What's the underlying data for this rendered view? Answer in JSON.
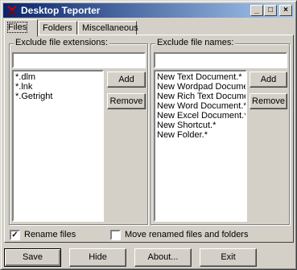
{
  "window": {
    "title": "Desktop Teporter"
  },
  "title_controls": {
    "minimize": "_",
    "maximize": "□",
    "close": "×"
  },
  "tabs": [
    {
      "label": "Files"
    },
    {
      "label": "Folders"
    },
    {
      "label": "Miscellaneous"
    }
  ],
  "extensions": {
    "legend": "Exclude file extensions:",
    "input_value": "",
    "items": [
      "*.dlm",
      "*.lnk",
      "*.Getright"
    ],
    "add_label": "Add",
    "remove_label": "Remove"
  },
  "names": {
    "legend": "Exclude file names:",
    "input_value": "",
    "items": [
      "New Text Document.*",
      "New Wordpad Documer",
      "New Rich Text Documer",
      "New Word Document.*",
      "New Excel Document.*",
      "New Shortcut.*",
      "New Folder.*"
    ],
    "add_label": "Add",
    "remove_label": "Remove"
  },
  "options": {
    "rename_files_label": "Rename files",
    "rename_files_checked": "✓",
    "move_renamed_label": "Move renamed files and folders",
    "move_renamed_checked": ""
  },
  "footer": {
    "save_label": "Save",
    "hide_label": "Hide",
    "about_label": "About...",
    "exit_label": "Exit"
  }
}
